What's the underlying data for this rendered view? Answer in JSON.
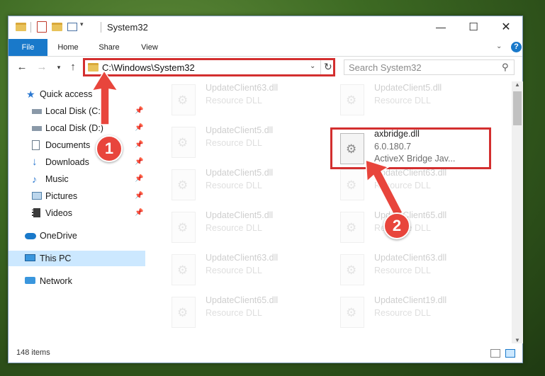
{
  "window": {
    "title": "System32",
    "controls": {
      "minimize": "—",
      "maximize": "☐",
      "close": "✕"
    }
  },
  "ribbon": {
    "tabs": [
      "File",
      "Home",
      "Share",
      "View"
    ],
    "help": "?"
  },
  "navigation": {
    "address": "C:\\Windows\\System32",
    "search_placeholder": "Search System32"
  },
  "sidebar": {
    "items": [
      {
        "label": "Quick access",
        "icon": "star-icon",
        "pinned": false
      },
      {
        "label": "Local Disk (C:)",
        "icon": "drive-icon",
        "pinned": true
      },
      {
        "label": "Local Disk (D:)",
        "icon": "drive-icon",
        "pinned": true
      },
      {
        "label": "Documents",
        "icon": "documents-icon",
        "pinned": true
      },
      {
        "label": "Downloads",
        "icon": "download-icon",
        "pinned": true
      },
      {
        "label": "Music",
        "icon": "music-icon",
        "pinned": true
      },
      {
        "label": "Pictures",
        "icon": "pictures-icon",
        "pinned": true
      },
      {
        "label": "Videos",
        "icon": "videos-icon",
        "pinned": true
      },
      {
        "label": "OneDrive",
        "icon": "cloud-icon",
        "pinned": false
      },
      {
        "label": "This PC",
        "icon": "computer-icon",
        "pinned": false,
        "selected": true
      },
      {
        "label": "Network",
        "icon": "network-icon",
        "pinned": false
      }
    ]
  },
  "files": [
    {
      "name": "UpdateClient63.dll",
      "type": "Resource DLL"
    },
    {
      "name": "UpdateClient5.dll",
      "type": "Resource DLL"
    },
    {
      "name": "UpdateClient5.dll",
      "type": "Resource DLL"
    },
    {
      "name": "axbridge.dll",
      "version": "6.0.180.7",
      "type": "ActiveX Bridge  Jav...",
      "highlighted": true
    },
    {
      "name": "UpdateClient5.dll",
      "type": "Resource DLL"
    },
    {
      "name": "UpdateClient63.dll",
      "type": "Resource DLL"
    },
    {
      "name": "UpdateClient5.dll",
      "type": "Resource DLL"
    },
    {
      "name": "UpdateClient65.dll",
      "type": "Resource DLL"
    },
    {
      "name": "UpdateClient63.dll",
      "type": "Resource DLL"
    },
    {
      "name": "UpdateClient63.dll",
      "type": "Resource DLL"
    },
    {
      "name": "UpdateClient65.dll",
      "type": "Resource DLL"
    },
    {
      "name": "UpdateClient19.dll",
      "type": "Resource DLL"
    }
  ],
  "status": {
    "item_count": "148 items"
  },
  "callouts": [
    "1",
    "2"
  ],
  "colors": {
    "accent": "#1979ca",
    "highlight": "#d32f2f",
    "marker": "#e8453c",
    "selected": "#cce8ff"
  }
}
